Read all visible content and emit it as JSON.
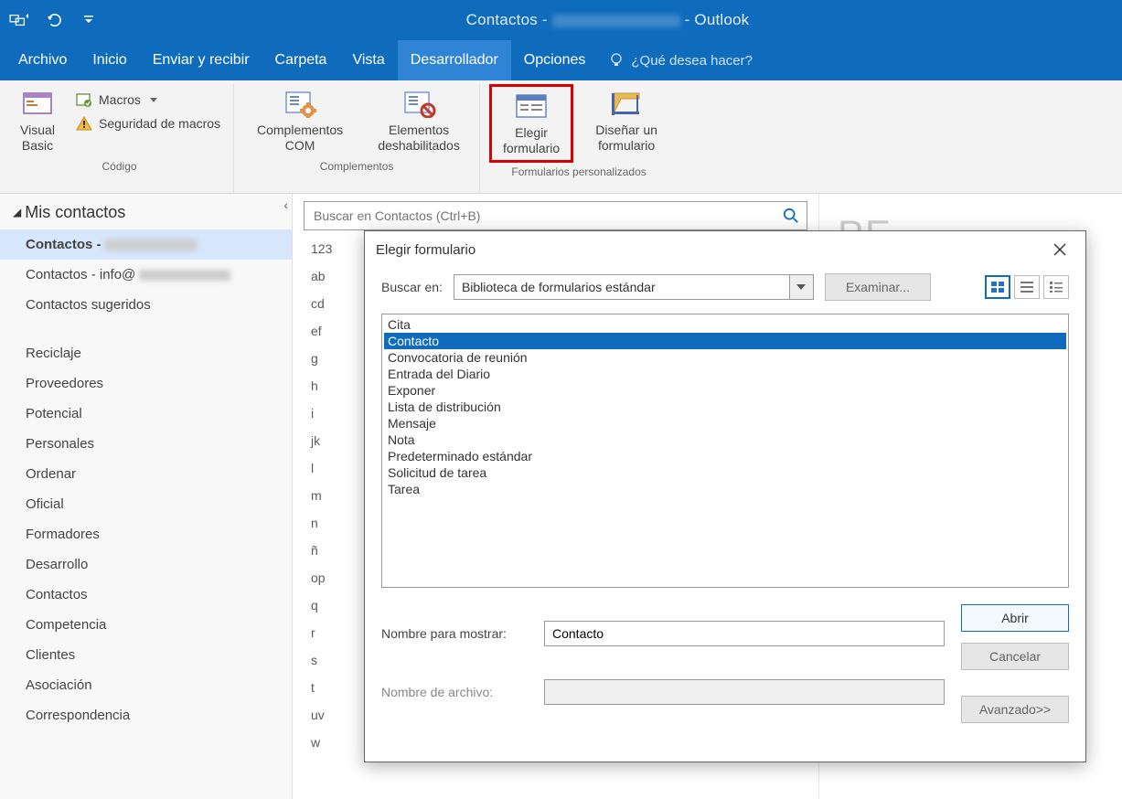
{
  "titlebar": {
    "title_left": "Contactos -",
    "title_right": "- Outlook"
  },
  "tabs": {
    "items": [
      "Archivo",
      "Inicio",
      "Enviar y recibir",
      "Carpeta",
      "Vista",
      "Desarrollador",
      "Opciones"
    ],
    "active_index": 5,
    "tellme": "¿Qué desea hacer?"
  },
  "ribbon": {
    "groups": {
      "codigo": {
        "label": "Código",
        "visual_basic": "Visual Basic",
        "macros": "Macros",
        "seguridad": "Seguridad de macros"
      },
      "complementos": {
        "label": "Complementos",
        "com": "Complementos COM",
        "deshab": "Elementos deshabilitados"
      },
      "formularios": {
        "label": "Formularios personalizados",
        "elegir": "Elegir formulario",
        "disenar": "Diseñar un formulario"
      }
    }
  },
  "nav": {
    "header": "Mis contactos",
    "items_top": [
      {
        "label": "Contactos -",
        "selected": true,
        "blurred": true
      },
      {
        "label": "Contactos - info@",
        "selected": false,
        "blurred": true
      },
      {
        "label": "Contactos sugeridos",
        "selected": false,
        "blurred": false
      }
    ],
    "items_bottom": [
      "Reciclaje",
      "Proveedores",
      "Potencial",
      "Personales",
      "Ordenar",
      "Oficial",
      "Formadores",
      "Desarrollo",
      "Contactos",
      "Competencia",
      "Clientes",
      "Asociación",
      "Correspondencia"
    ]
  },
  "search": {
    "placeholder": "Buscar en Contactos (Ctrl+B)"
  },
  "alpha": [
    "123",
    "ab",
    "cd",
    "ef",
    "g",
    "h",
    "i",
    "jk",
    "l",
    "m",
    "n",
    "ñ",
    "op",
    "q",
    "r",
    "s",
    "t",
    "uv",
    "w"
  ],
  "dialog": {
    "title": "Elegir formulario",
    "buscar_en_label": "Buscar en:",
    "buscar_en_value": "Biblioteca de formularios estándar",
    "examinar": "Examinar...",
    "list": [
      "Cita",
      "Contacto",
      "Convocatoria de reunión",
      "Entrada del Diario",
      "Exponer",
      "Lista de distribución",
      "Mensaje",
      "Nota",
      "Predeterminado estándar",
      "Solicitud de tarea",
      "Tarea"
    ],
    "selected_index": 1,
    "nombre_mostrar_label": "Nombre para mostrar:",
    "nombre_mostrar_value": "Contacto",
    "nombre_archivo_label": "Nombre de archivo:",
    "nombre_archivo_value": "",
    "abrir": "Abrir",
    "cancelar": "Cancelar",
    "avanzado": "Avanzado>>"
  }
}
